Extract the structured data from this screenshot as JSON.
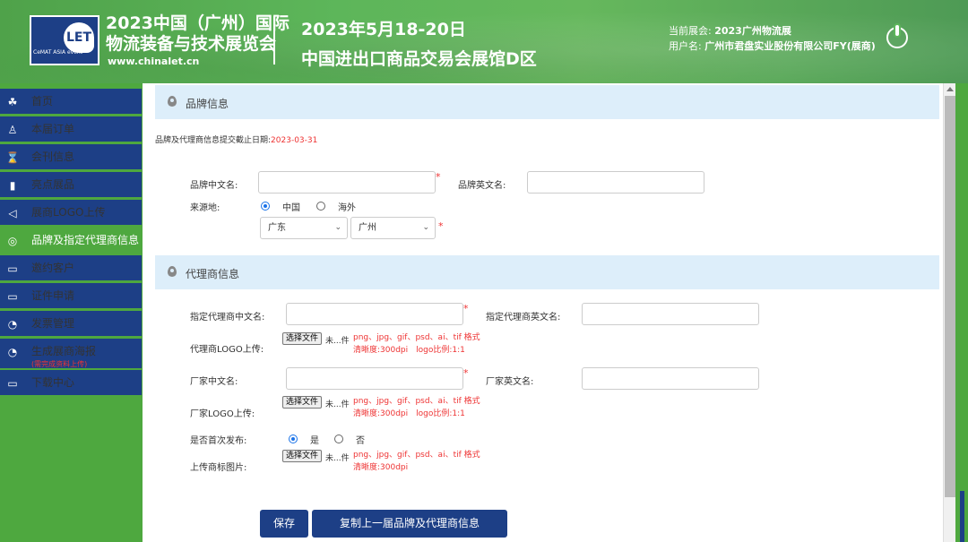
{
  "header": {
    "title_line1": "2023中国（广州）国际",
    "title_line2": "物流装备与技术展览会",
    "url": "www.chinalet.cn",
    "logo_text": "LET",
    "logo_sub": "CeMAT ASIA event",
    "date": "2023年5月18-20日",
    "venue": "中国进出口商品交易会展馆D区",
    "current_show_label": "当前展会:",
    "current_show_value": "2023广州物流展",
    "user_label": "用户名:",
    "user_value": "广州市君盘实业股份有限公司FY(展商)"
  },
  "sidebar": {
    "items": [
      {
        "label": "首页",
        "icon": "handshake-icon"
      },
      {
        "label": "本届订单",
        "icon": "user-icon"
      },
      {
        "label": "会刊信息",
        "icon": "hourglass-icon"
      },
      {
        "label": "亮点展品",
        "icon": "bar-chart-icon"
      },
      {
        "label": "展商LOGO上传",
        "icon": "megaphone-icon"
      },
      {
        "label": "品牌及指定代理商信息",
        "icon": "coin-icon"
      },
      {
        "label": "邀约客户",
        "icon": "folder-icon"
      },
      {
        "label": "证件申请",
        "icon": "folder-icon"
      },
      {
        "label": "发票管理",
        "icon": "pie-chart-icon"
      },
      {
        "label": "生成展商海报",
        "icon": "pie-chart-icon",
        "sub": "(需完成资料上传)"
      },
      {
        "label": "下载中心",
        "icon": "folder-icon"
      }
    ]
  },
  "brand_section": {
    "title": "品牌信息",
    "deadline_label": "品牌及代理商信息提交截止日期:",
    "deadline_value": "2023-03-31",
    "cn_name_label": "品牌中文名:",
    "en_name_label": "品牌英文名:",
    "origin_label": "来源地:",
    "origin_options": [
      "中国",
      "海外"
    ],
    "province": "广东",
    "city": "广州"
  },
  "agent_section": {
    "title": "代理商信息",
    "agent_cn_label": "指定代理商中文名:",
    "agent_en_label": "指定代理商英文名:",
    "agent_logo_label": "代理商LOGO上传:",
    "maker_cn_label": "厂家中文名:",
    "maker_en_label": "厂家英文名:",
    "maker_logo_label": "厂家LOGO上传:",
    "first_release_label": "是否首次发布:",
    "first_release_options": [
      "是",
      "否"
    ],
    "trademark_label": "上传商标图片:",
    "choose_file": "选择文件",
    "no_file": "未...件",
    "format_hint": "png、jpg、gif、psd、ai、tif 格式",
    "res_hint_logo": "清晰度:300dpi　logo比例:1:1",
    "res_hint_plain": "清晰度:300dpi"
  },
  "actions": {
    "save": "保存",
    "copy_prev": "复制上一届品牌及代理商信息"
  }
}
